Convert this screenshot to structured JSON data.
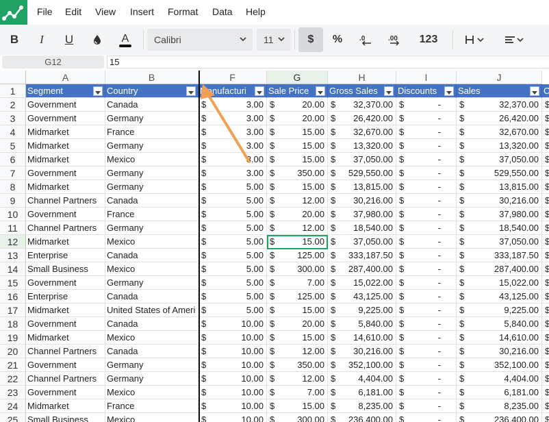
{
  "menu": [
    "File",
    "Edit",
    "View",
    "Insert",
    "Format",
    "Data",
    "Help"
  ],
  "toolbar": {
    "font_name": "Calibri",
    "font_size": "11",
    "currency_label": "$",
    "percent_label": "%",
    "number_format_label": "123"
  },
  "formula_bar": {
    "cell_ref": "G12",
    "value": "15"
  },
  "columns": [
    "A",
    "B",
    "F",
    "G",
    "H",
    "I",
    "J"
  ],
  "selected_column": "G",
  "selected_row": "12",
  "headers": [
    "Segment",
    "Country",
    "Manufacturi",
    "Sale Price",
    "Gross Sales",
    "Discounts",
    "Sales"
  ],
  "header_next_col_partial": "C",
  "currency_symbol": "$",
  "rows": [
    {
      "n": "1"
    },
    {
      "n": "2",
      "segment": "Government",
      "country": "Canada",
      "mfg": "3.00",
      "price": "20.00",
      "gross": "32,370.00",
      "disc": "-",
      "sales": "32,370.00"
    },
    {
      "n": "3",
      "segment": "Government",
      "country": "Germany",
      "mfg": "3.00",
      "price": "20.00",
      "gross": "26,420.00",
      "disc": "-",
      "sales": "26,420.00"
    },
    {
      "n": "4",
      "segment": "Midmarket",
      "country": "France",
      "mfg": "3.00",
      "price": "15.00",
      "gross": "32,670.00",
      "disc": "-",
      "sales": "32,670.00"
    },
    {
      "n": "5",
      "segment": "Midmarket",
      "country": "Germany",
      "mfg": "3.00",
      "price": "15.00",
      "gross": "13,320.00",
      "disc": "-",
      "sales": "13,320.00"
    },
    {
      "n": "6",
      "segment": "Midmarket",
      "country": "Mexico",
      "mfg": "3.00",
      "price": "15.00",
      "gross": "37,050.00",
      "disc": "-",
      "sales": "37,050.00"
    },
    {
      "n": "7",
      "segment": "Government",
      "country": "Germany",
      "mfg": "3.00",
      "price": "350.00",
      "gross": "529,550.00",
      "disc": "-",
      "sales": "529,550.00"
    },
    {
      "n": "8",
      "segment": "Midmarket",
      "country": "Germany",
      "mfg": "5.00",
      "price": "15.00",
      "gross": "13,815.00",
      "disc": "-",
      "sales": "13,815.00"
    },
    {
      "n": "9",
      "segment": "Channel Partners",
      "country": "Canada",
      "mfg": "5.00",
      "price": "12.00",
      "gross": "30,216.00",
      "disc": "-",
      "sales": "30,216.00"
    },
    {
      "n": "10",
      "segment": "Government",
      "country": "France",
      "mfg": "5.00",
      "price": "20.00",
      "gross": "37,980.00",
      "disc": "-",
      "sales": "37,980.00"
    },
    {
      "n": "11",
      "segment": "Channel Partners",
      "country": "Germany",
      "mfg": "5.00",
      "price": "12.00",
      "gross": "18,540.00",
      "disc": "-",
      "sales": "18,540.00"
    },
    {
      "n": "12",
      "segment": "Midmarket",
      "country": "Mexico",
      "mfg": "5.00",
      "price": "15.00",
      "gross": "37,050.00",
      "disc": "-",
      "sales": "37,050.00"
    },
    {
      "n": "13",
      "segment": "Enterprise",
      "country": "Canada",
      "mfg": "5.00",
      "price": "125.00",
      "gross": "333,187.50",
      "disc": "-",
      "sales": "333,187.50"
    },
    {
      "n": "14",
      "segment": "Small Business",
      "country": "Mexico",
      "mfg": "5.00",
      "price": "300.00",
      "gross": "287,400.00",
      "disc": "-",
      "sales": "287,400.00"
    },
    {
      "n": "15",
      "segment": "Government",
      "country": "Germany",
      "mfg": "5.00",
      "price": "7.00",
      "gross": "15,022.00",
      "disc": "-",
      "sales": "15,022.00"
    },
    {
      "n": "16",
      "segment": "Enterprise",
      "country": "Canada",
      "mfg": "5.00",
      "price": "125.00",
      "gross": "43,125.00",
      "disc": "-",
      "sales": "43,125.00"
    },
    {
      "n": "17",
      "segment": "Midmarket",
      "country": "United States of Ameri",
      "mfg": "5.00",
      "price": "15.00",
      "gross": "9,225.00",
      "disc": "-",
      "sales": "9,225.00"
    },
    {
      "n": "18",
      "segment": "Government",
      "country": "Canada",
      "mfg": "10.00",
      "price": "20.00",
      "gross": "5,840.00",
      "disc": "-",
      "sales": "5,840.00"
    },
    {
      "n": "19",
      "segment": "Midmarket",
      "country": "Mexico",
      "mfg": "10.00",
      "price": "15.00",
      "gross": "14,610.00",
      "disc": "-",
      "sales": "14,610.00"
    },
    {
      "n": "20",
      "segment": "Channel Partners",
      "country": "Canada",
      "mfg": "10.00",
      "price": "12.00",
      "gross": "30,216.00",
      "disc": "-",
      "sales": "30,216.00"
    },
    {
      "n": "21",
      "segment": "Government",
      "country": "Germany",
      "mfg": "10.00",
      "price": "350.00",
      "gross": "352,100.00",
      "disc": "-",
      "sales": "352,100.00"
    },
    {
      "n": "22",
      "segment": "Channel Partners",
      "country": "Germany",
      "mfg": "10.00",
      "price": "12.00",
      "gross": "4,404.00",
      "disc": "-",
      "sales": "4,404.00"
    },
    {
      "n": "23",
      "segment": "Government",
      "country": "Mexico",
      "mfg": "10.00",
      "price": "7.00",
      "gross": "6,181.00",
      "disc": "-",
      "sales": "6,181.00"
    },
    {
      "n": "24",
      "segment": "Midmarket",
      "country": "France",
      "mfg": "10.00",
      "price": "15.00",
      "gross": "8,235.00",
      "disc": "-",
      "sales": "8,235.00"
    },
    {
      "n": "25",
      "segment": "Small Business",
      "country": "Mexico",
      "mfg": "10.00",
      "price": "300.00",
      "gross": "236,400.00",
      "disc": "-",
      "sales": "236,400.00"
    }
  ],
  "colors": {
    "app_green": "#21a366",
    "header_blue": "#4472c4",
    "selection_green": "#21a366",
    "annotation_arrow": "#f0a050"
  }
}
